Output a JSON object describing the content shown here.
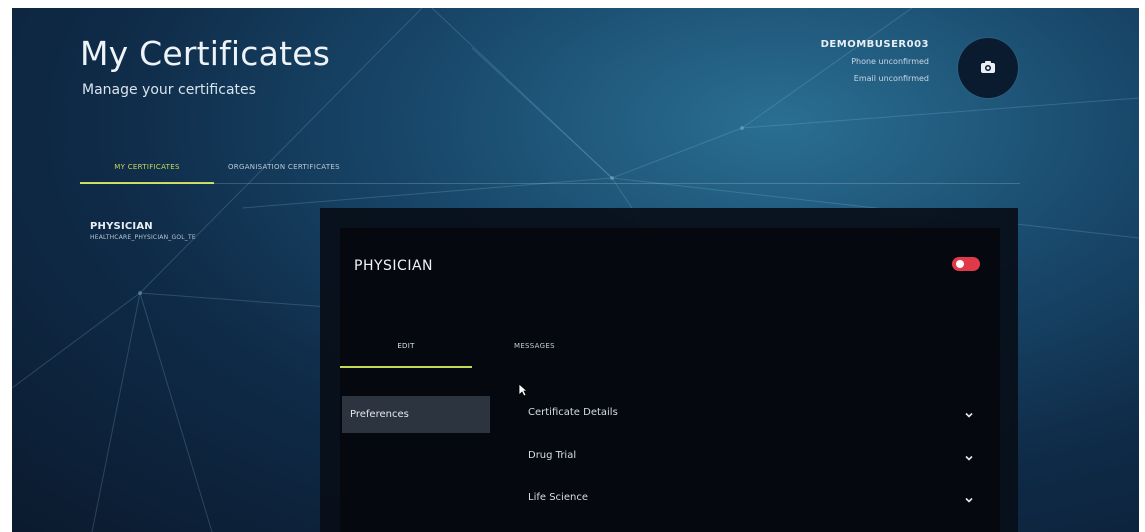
{
  "header": {
    "title": "My Certificates",
    "subtitle": "Manage your certificates",
    "user": {
      "name": "DEMOMBUSER003",
      "phone_status": "Phone unconfirmed",
      "email_status": "Email unconfirmed"
    },
    "avatar_icon": "camera-icon"
  },
  "tabs": [
    {
      "label": "MY CERTIFICATES",
      "active": true
    },
    {
      "label": "ORGANISATION CERTIFICATES",
      "active": false
    }
  ],
  "certificates": [
    {
      "name": "PHYSICIAN",
      "code": "HEALTHCARE_PHYSICIAN_GOL_TE"
    }
  ],
  "detail": {
    "title": "PHYSICIAN",
    "toggle_on": true,
    "tabs": [
      {
        "label": "EDIT",
        "active": true
      },
      {
        "label": "MESSAGES",
        "active": false
      }
    ],
    "sidebar": [
      {
        "label": "Preferences",
        "active": true
      }
    ],
    "sections": [
      {
        "label": "Certificate Details"
      },
      {
        "label": "Drug Trial"
      },
      {
        "label": "Life Science"
      }
    ]
  },
  "colors": {
    "accent": "#c6d955",
    "toggle": "#e0394a",
    "background_dark": "#0b1a2e",
    "background_light": "#2a6f92"
  }
}
